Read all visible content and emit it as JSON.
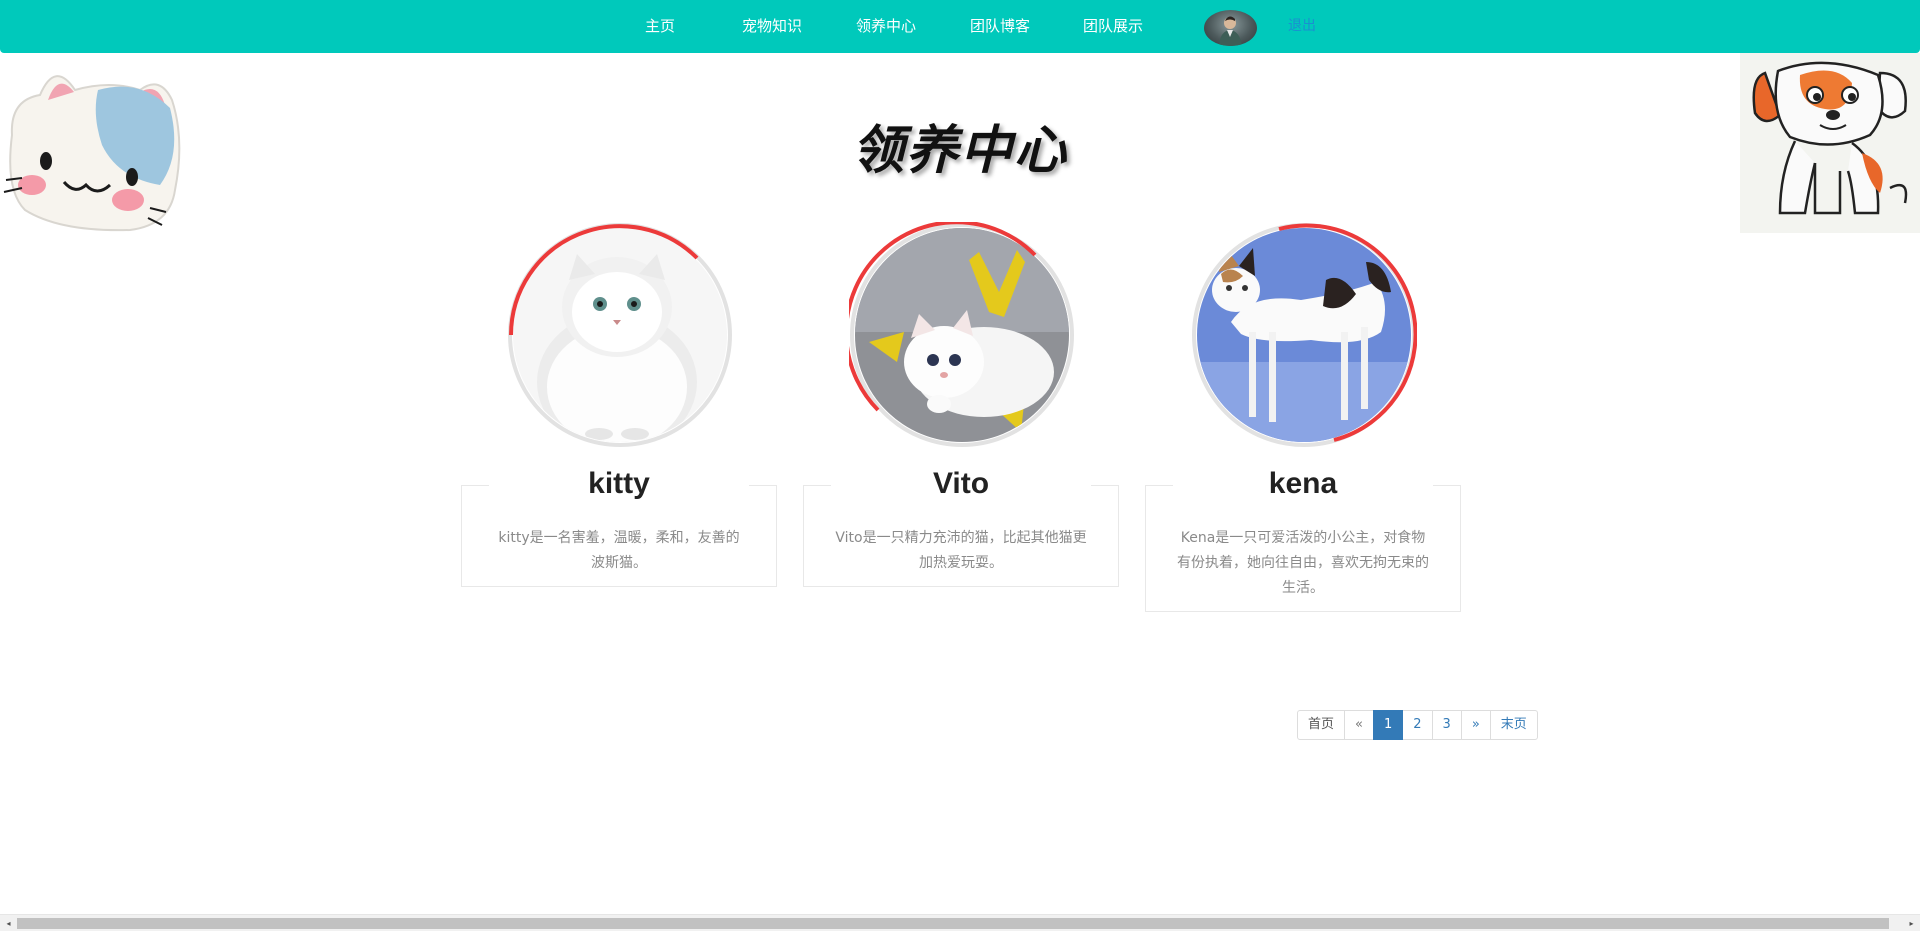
{
  "nav": {
    "items": [
      {
        "label": "主页"
      },
      {
        "label": "宠物知识"
      },
      {
        "label": "领养中心"
      },
      {
        "label": "团队博客"
      },
      {
        "label": "团队展示"
      }
    ],
    "logout_label": "退出",
    "accent_color": "#00c9bb",
    "avatar_icon": "user-avatar"
  },
  "main": {
    "title": "领养中心",
    "pets": [
      {
        "name": "kitty",
        "description": "kitty是一名害羞，温暖，柔和，友善的波斯猫。"
      },
      {
        "name": "Vito",
        "description": "Vito是一只精力充沛的猫，比起其他猫更加热爱玩耍。"
      },
      {
        "name": "kena",
        "description": "Kena是一只可爱活泼的小公主，对食物有份执着，她向往自由，喜欢无拘无束的生活。"
      }
    ]
  },
  "pagination": {
    "first": "首页",
    "prev": "«",
    "pages": [
      "1",
      "2",
      "3"
    ],
    "active_page": "1",
    "next": "»",
    "last": "末页"
  },
  "decorations": {
    "left_icon": "cartoon-cat-face",
    "right_icon": "cartoon-dog-drawing"
  },
  "scrollbar": {
    "left_arrow": "◂",
    "right_arrow": "▸"
  }
}
